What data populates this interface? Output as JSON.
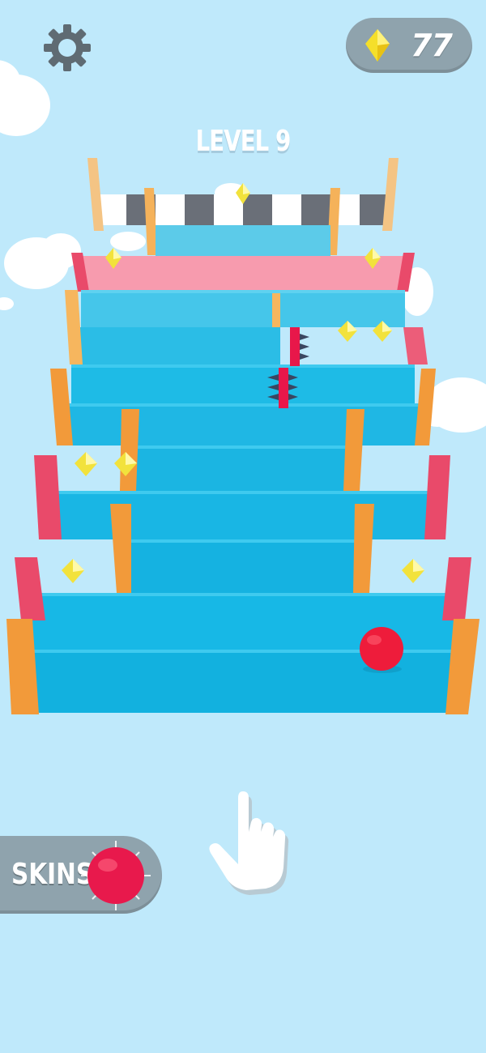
{
  "hud": {
    "settings_icon": "gear-icon",
    "gem_icon": "diamond-icon",
    "gem_count": "77",
    "level_title": "LEVEL 9"
  },
  "skins": {
    "label": "SKINS",
    "ball_icon": "red-ball-icon"
  },
  "hint": {
    "icon": "tap-hand-icon"
  },
  "colors": {
    "sky": "#bfe9fb",
    "step_top": "#3fc6ea",
    "step_front": "#14b4e4",
    "rail_orange": "#f4a63c",
    "rail_pink": "#ec5d79",
    "ball": "#ee1c3b",
    "gem": "#f2e23c",
    "hud_bg": "#8fa3ad"
  }
}
